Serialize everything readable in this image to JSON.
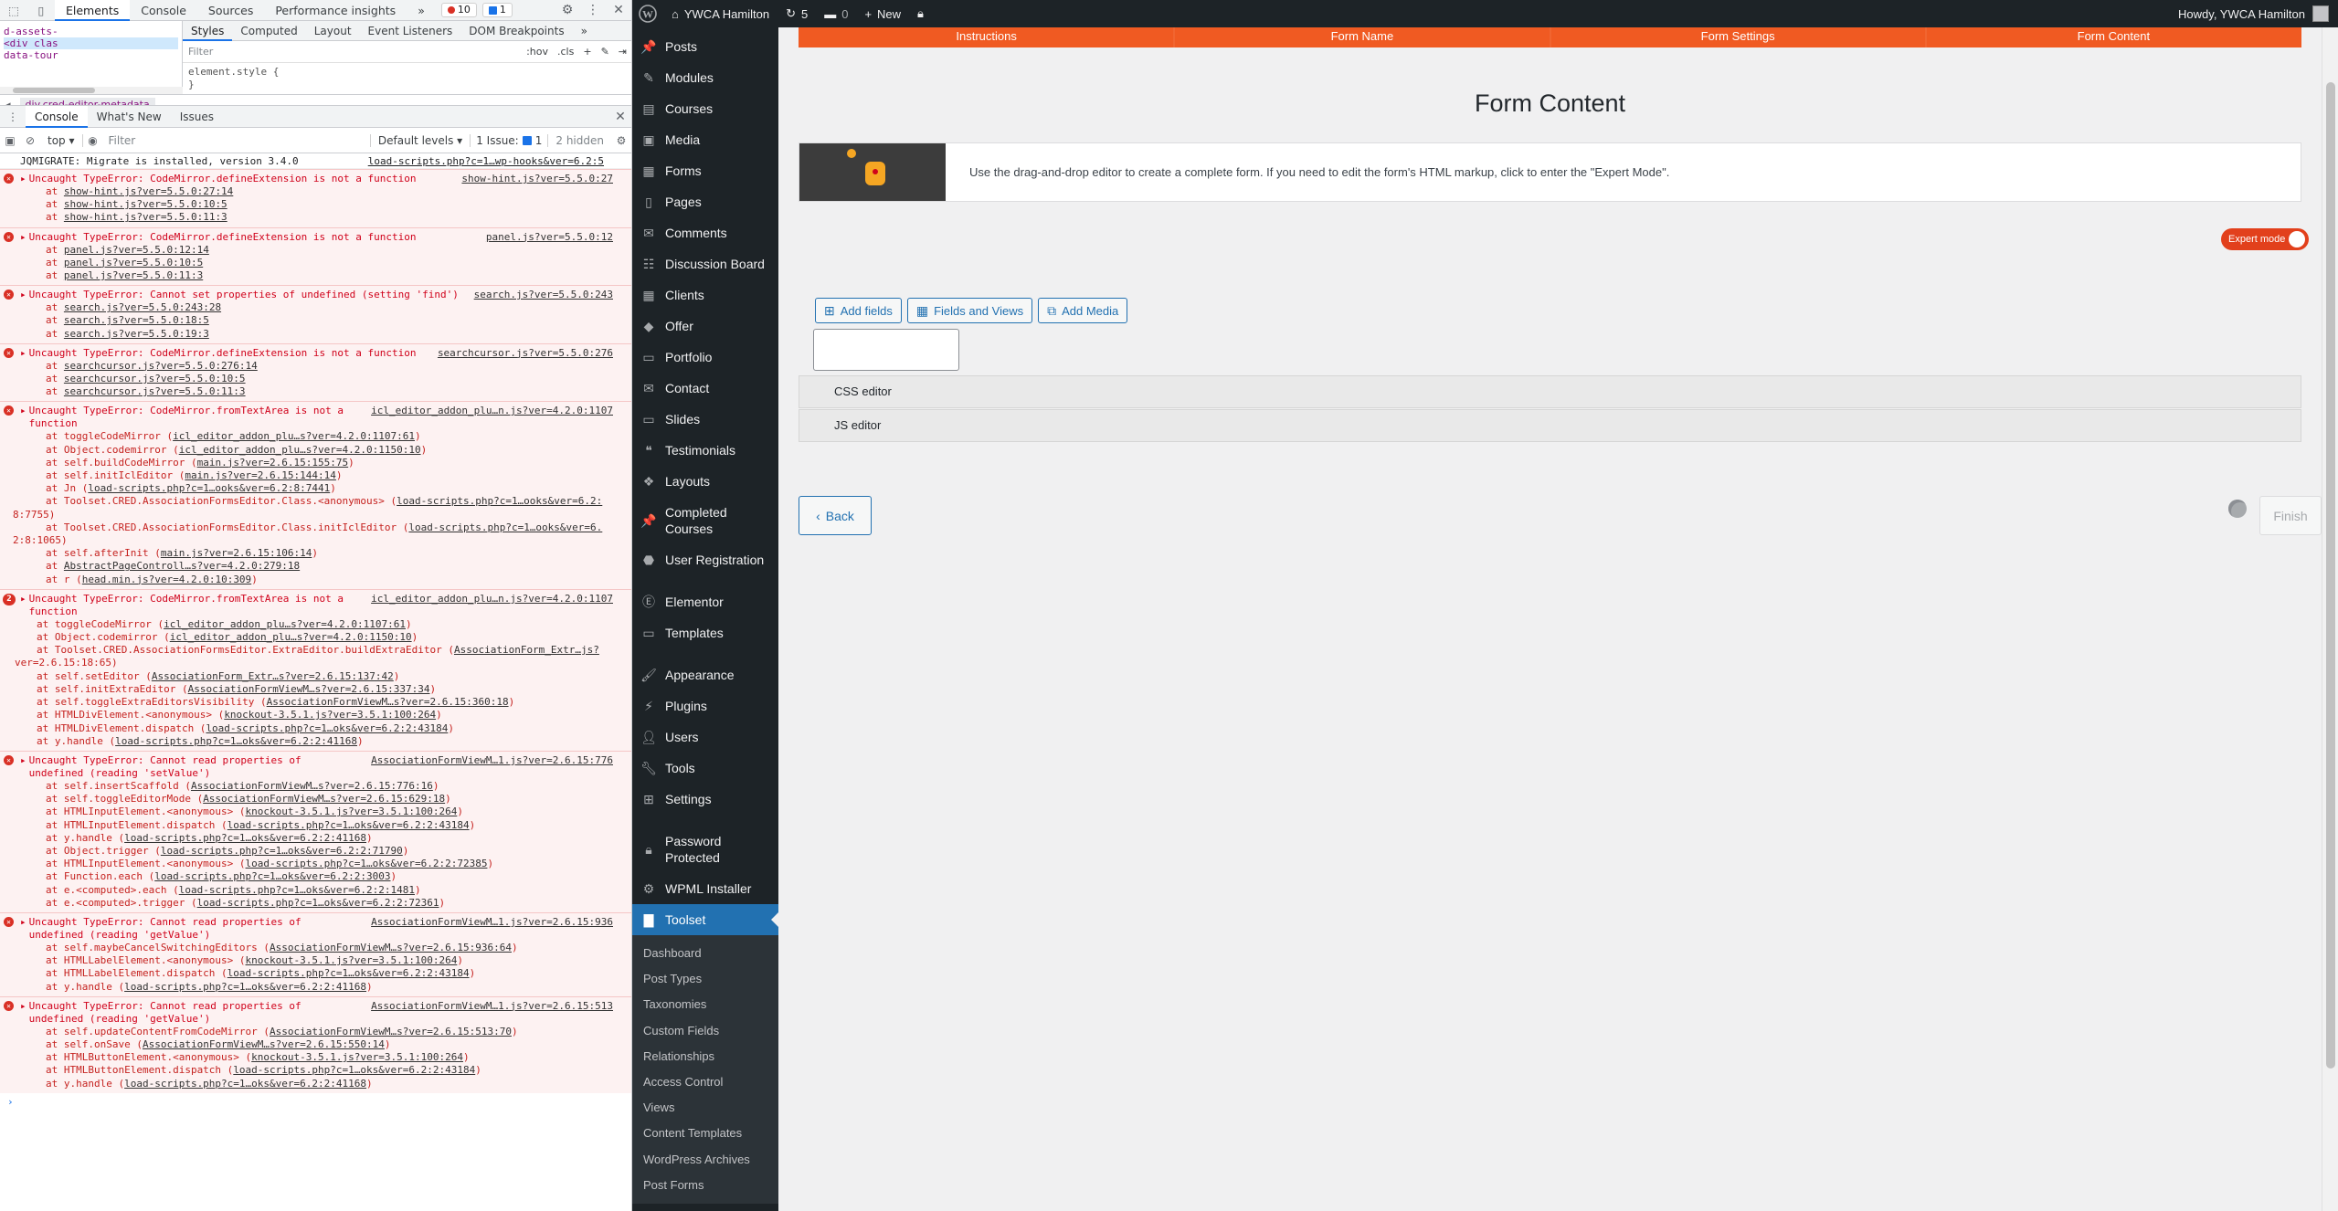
{
  "devtools": {
    "tabs": [
      "Elements",
      "Console",
      "Sources",
      "Performance insights"
    ],
    "error_count": "10",
    "issue_count": "1",
    "dom_lines": [
      "d-assets-",
      "<div clas",
      "data-tour"
    ],
    "styles_tabs": [
      "Styles",
      "Computed",
      "Layout",
      "Event Listeners",
      "DOM Breakpoints"
    ],
    "styles_filter_placeholder": "Filter",
    "hov": ":hov",
    "cls": ".cls",
    "element_style": "element.style {",
    "element_style_close": "}",
    "breadcrumb": "div.cred-editor-metadata",
    "drawer_tabs": [
      "Console",
      "What's New",
      "Issues"
    ],
    "console": {
      "context": "top",
      "filter_placeholder": "Filter",
      "levels": "Default levels",
      "issues": "1 Issue:",
      "issues_count": "1",
      "hidden": "2 hidden",
      "info_line": {
        "text": "JQMIGRATE: Migrate is installed, version 3.4.0",
        "src": "load-scripts.php?c=1…wp-hooks&ver=6.2:5"
      },
      "errors": [
        {
          "text": "Uncaught TypeError: CodeMirror.defineExtension is not a function",
          "src": "show-hint.js?ver=5.5.0:27",
          "frames": [
            {
              "p": "at ",
              "l": "show-hint.js?ver=5.5.0:27:14"
            },
            {
              "p": "at ",
              "l": "show-hint.js?ver=5.5.0:10:5"
            },
            {
              "p": "at ",
              "l": "show-hint.js?ver=5.5.0:11:3"
            }
          ]
        },
        {
          "text": "Uncaught TypeError: CodeMirror.defineExtension is not a function",
          "src": "panel.js?ver=5.5.0:12",
          "frames": [
            {
              "p": "at ",
              "l": "panel.js?ver=5.5.0:12:14"
            },
            {
              "p": "at ",
              "l": "panel.js?ver=5.5.0:10:5"
            },
            {
              "p": "at ",
              "l": "panel.js?ver=5.5.0:11:3"
            }
          ]
        },
        {
          "text": "Uncaught TypeError: Cannot set properties of undefined (setting 'find')",
          "src": "search.js?ver=5.5.0:243",
          "frames": [
            {
              "p": "at ",
              "l": "search.js?ver=5.5.0:243:28"
            },
            {
              "p": "at ",
              "l": "search.js?ver=5.5.0:18:5"
            },
            {
              "p": "at ",
              "l": "search.js?ver=5.5.0:19:3"
            }
          ]
        },
        {
          "text": "Uncaught TypeError: CodeMirror.defineExtension is not a function",
          "src": "searchcursor.js?ver=5.5.0:276",
          "frames": [
            {
              "p": "at ",
              "l": "searchcursor.js?ver=5.5.0:276:14"
            },
            {
              "p": "at ",
              "l": "searchcursor.js?ver=5.5.0:10:5"
            },
            {
              "p": "at ",
              "l": "searchcursor.js?ver=5.5.0:11:3"
            }
          ]
        },
        {
          "text": "Uncaught TypeError: CodeMirror.fromTextArea is not a\nfunction",
          "src": "icl_editor_addon_plu…n.js?ver=4.2.0:1107",
          "frames": [
            {
              "p": "at toggleCodeMirror (",
              "l": "icl_editor_addon_plu…s?ver=4.2.0:1107:61",
              "s": ")"
            },
            {
              "p": "at Object.codemirror (",
              "l": "icl_editor_addon_plu…s?ver=4.2.0:1150:10",
              "s": ")"
            },
            {
              "p": "at self.buildCodeMirror (",
              "l": "main.js?ver=2.6.15:155:75",
              "s": ")"
            },
            {
              "p": "at self.initIclEditor (",
              "l": "main.js?ver=2.6.15:144:14",
              "s": ")"
            },
            {
              "p": "at Jn (",
              "l": "load-scripts.php?c=1…ooks&ver=6.2:8:7441",
              "s": ")"
            },
            {
              "p": "at Toolset.CRED.AssociationFormsEditor.Class.<anonymous> (",
              "l": "load-scripts.php?c=1…ooks&ver=6.2:",
              "s": ""
            },
            {
              "p": "8:7755)",
              "l": "",
              "s": "",
              "cont": true
            },
            {
              "p": "at Toolset.CRED.AssociationFormsEditor.Class.initIclEditor (",
              "l": "load-scripts.php?c=1…ooks&ver=6.",
              "s": ""
            },
            {
              "p": "2:8:1065)",
              "l": "",
              "s": "",
              "cont": true
            },
            {
              "p": "at self.afterInit (",
              "l": "main.js?ver=2.6.15:106:14",
              "s": ")"
            },
            {
              "p": "at ",
              "l": "AbstractPageControll…s?ver=4.2.0:279:18",
              "s": ""
            },
            {
              "p": "at r (",
              "l": "head.min.js?ver=4.2.0:10:309",
              "s": ")"
            }
          ]
        },
        {
          "count": "2",
          "text": "Uncaught TypeError: CodeMirror.fromTextArea is not a\nfunction",
          "src": "icl_editor_addon_plu…n.js?ver=4.2.0:1107",
          "frames": [
            {
              "p": "at toggleCodeMirror (",
              "l": "icl_editor_addon_plu…s?ver=4.2.0:1107:61",
              "s": ")"
            },
            {
              "p": "at Object.codemirror (",
              "l": "icl_editor_addon_plu…s?ver=4.2.0:1150:10",
              "s": ")"
            },
            {
              "p": "at Toolset.CRED.AssociationFormsEditor.ExtraEditor.buildExtraEditor (",
              "l": "AssociationForm_Extr…js?",
              "s": ""
            },
            {
              "p": "ver=2.6.15:18:65)",
              "l": "",
              "s": "",
              "cont": true
            },
            {
              "p": "at self.setEditor (",
              "l": "AssociationForm_Extr…s?ver=2.6.15:137:42",
              "s": ")"
            },
            {
              "p": "at self.initExtraEditor (",
              "l": "AssociationFormViewM…s?ver=2.6.15:337:34",
              "s": ")"
            },
            {
              "p": "at self.toggleExtraEditorsVisibility (",
              "l": "AssociationFormViewM…s?ver=2.6.15:360:18",
              "s": ")"
            },
            {
              "p": "at HTMLDivElement.<anonymous> (",
              "l": "knockout-3.5.1.js?ver=3.5.1:100:264",
              "s": ")"
            },
            {
              "p": "at HTMLDivElement.dispatch (",
              "l": "load-scripts.php?c=1…oks&ver=6.2:2:43184",
              "s": ")"
            },
            {
              "p": "at y.handle (",
              "l": "load-scripts.php?c=1…oks&ver=6.2:2:41168",
              "s": ")"
            }
          ]
        },
        {
          "text": "Uncaught TypeError: Cannot read properties of\nundefined (reading 'setValue')",
          "src": "AssociationFormViewM…1.js?ver=2.6.15:776",
          "frames": [
            {
              "p": "at self.insertScaffold (",
              "l": "AssociationFormViewM…s?ver=2.6.15:776:16",
              "s": ")"
            },
            {
              "p": "at self.toggleEditorMode (",
              "l": "AssociationFormViewM…s?ver=2.6.15:629:18",
              "s": ")"
            },
            {
              "p": "at HTMLInputElement.<anonymous> (",
              "l": "knockout-3.5.1.js?ver=3.5.1:100:264",
              "s": ")"
            },
            {
              "p": "at HTMLInputElement.dispatch (",
              "l": "load-scripts.php?c=1…oks&ver=6.2:2:43184",
              "s": ")"
            },
            {
              "p": "at y.handle (",
              "l": "load-scripts.php?c=1…oks&ver=6.2:2:41168",
              "s": ")"
            },
            {
              "p": "at Object.trigger (",
              "l": "load-scripts.php?c=1…oks&ver=6.2:2:71790",
              "s": ")"
            },
            {
              "p": "at HTMLInputElement.<anonymous> (",
              "l": "load-scripts.php?c=1…oks&ver=6.2:2:72385",
              "s": ")"
            },
            {
              "p": "at Function.each (",
              "l": "load-scripts.php?c=1…oks&ver=6.2:2:3003",
              "s": ")"
            },
            {
              "p": "at e.<computed>.each (",
              "l": "load-scripts.php?c=1…oks&ver=6.2:2:1481",
              "s": ")"
            },
            {
              "p": "at e.<computed>.trigger (",
              "l": "load-scripts.php?c=1…oks&ver=6.2:2:72361",
              "s": ")"
            }
          ]
        },
        {
          "text": "Uncaught TypeError: Cannot read properties of\nundefined (reading 'getValue')",
          "src": "AssociationFormViewM…1.js?ver=2.6.15:936",
          "frames": [
            {
              "p": "at self.maybeCancelSwitchingEditors (",
              "l": "AssociationFormViewM…s?ver=2.6.15:936:64",
              "s": ")"
            },
            {
              "p": "at HTMLLabelElement.<anonymous> (",
              "l": "knockout-3.5.1.js?ver=3.5.1:100:264",
              "s": ")"
            },
            {
              "p": "at HTMLLabelElement.dispatch (",
              "l": "load-scripts.php?c=1…oks&ver=6.2:2:43184",
              "s": ")"
            },
            {
              "p": "at y.handle (",
              "l": "load-scripts.php?c=1…oks&ver=6.2:2:41168",
              "s": ")"
            }
          ]
        },
        {
          "text": "Uncaught TypeError: Cannot read properties of\nundefined (reading 'getValue')",
          "src": "AssociationFormViewM…1.js?ver=2.6.15:513",
          "frames": [
            {
              "p": "at self.updateContentFromCodeMirror (",
              "l": "AssociationFormViewM…s?ver=2.6.15:513:70",
              "s": ")"
            },
            {
              "p": "at self.onSave (",
              "l": "AssociationFormViewM…s?ver=2.6.15:550:14",
              "s": ")"
            },
            {
              "p": "at HTMLButtonElement.<anonymous> (",
              "l": "knockout-3.5.1.js?ver=3.5.1:100:264",
              "s": ")"
            },
            {
              "p": "at HTMLButtonElement.dispatch (",
              "l": "load-scripts.php?c=1…oks&ver=6.2:2:43184",
              "s": ")"
            },
            {
              "p": "at y.handle (",
              "l": "load-scripts.php?c=1…oks&ver=6.2:2:41168",
              "s": ")"
            }
          ]
        }
      ],
      "prompt": "›"
    }
  },
  "adminbar": {
    "site_name": "YWCA Hamilton",
    "updates": "5",
    "comments": "0",
    "new_label": "New",
    "greeting": "Howdy, YWCA Hamilton"
  },
  "sidebar": {
    "items": [
      {
        "label": "Posts",
        "icon": "📌"
      },
      {
        "label": "Modules",
        "icon": "✎"
      },
      {
        "label": "Courses",
        "icon": "▤"
      },
      {
        "label": "Media",
        "icon": "▣"
      },
      {
        "label": "Forms",
        "icon": "▦"
      },
      {
        "label": "Pages",
        "icon": "▯"
      },
      {
        "label": "Comments",
        "icon": "✉"
      },
      {
        "label": "Discussion Board",
        "icon": "☷"
      },
      {
        "label": "Clients",
        "icon": "▦"
      },
      {
        "label": "Offer",
        "icon": "◆"
      },
      {
        "label": "Portfolio",
        "icon": "▭"
      },
      {
        "label": "Contact",
        "icon": "✉"
      },
      {
        "label": "Slides",
        "icon": "▭"
      },
      {
        "label": "Testimonials",
        "icon": "❝"
      }
    ],
    "layouts": "Layouts",
    "completed_courses": "Completed\nCourses",
    "user_registration": "User Registration",
    "elementor": "Elementor",
    "templates": "Templates",
    "appearance": "Appearance",
    "plugins": "Plugins",
    "users": "Users",
    "tools": "Tools",
    "settings": "Settings",
    "password_protected": "Password\nProtected",
    "wpml_installer": "WPML Installer",
    "toolset": "Toolset",
    "submenu": [
      "Dashboard",
      "Post Types",
      "Taxonomies",
      "Custom Fields",
      "Relationships",
      "Access Control",
      "Views",
      "Content Templates",
      "WordPress Archives",
      "Post Forms"
    ]
  },
  "main": {
    "wizard_steps": [
      "Instructions",
      "Form Name",
      "Form Settings",
      "Form Content"
    ],
    "title": "Form Content",
    "notice": "Use the drag-and-drop editor to create a complete form. If you need to edit the form's HTML markup, click to enter the \"Expert Mode\".",
    "expert_mode": "Expert mode",
    "add_fields": "Add fields",
    "fields_and_views": "Fields and Views",
    "add_media": "Add Media",
    "css_editor": "CSS editor",
    "js_editor": "JS editor",
    "back": "Back",
    "finish": "Finish"
  }
}
